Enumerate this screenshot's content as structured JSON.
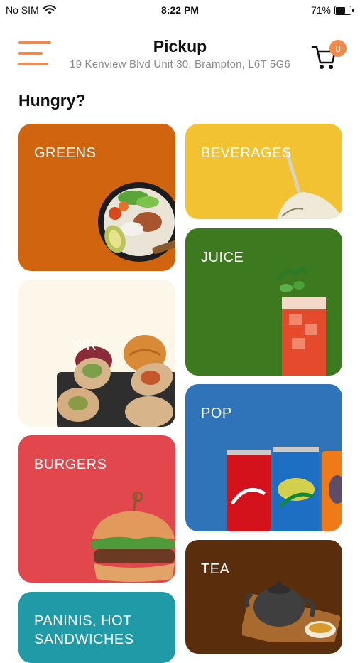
{
  "status_bar": {
    "carrier": "No SIM",
    "time": "8:22 PM",
    "battery": "71%",
    "battery_level": 0.71
  },
  "header": {
    "title": "Pickup",
    "address": "19 Kenview Blvd Unit 30, Brampton, L6T 5G6",
    "cart_count": "0"
  },
  "section_title": "Hungry?",
  "categories": [
    {
      "label": "GREENS",
      "color": "#d0640f"
    },
    {
      "label": "BEVERAGES",
      "color": "#f3c233"
    },
    {
      "label": "JUICE",
      "color": "#3d7a1f"
    },
    {
      "label": "WR",
      "color": "#fdf7ea"
    },
    {
      "label": "POP",
      "color": "#2f73b8"
    },
    {
      "label": "BURGERS",
      "color": "#e2474e"
    },
    {
      "label": "TEA",
      "color": "#5a2d0c"
    },
    {
      "label": "PANINIS, HOT SANDWICHES",
      "color": "#1f9aa6"
    }
  ],
  "colors": {
    "accent": "#f28a4b"
  }
}
